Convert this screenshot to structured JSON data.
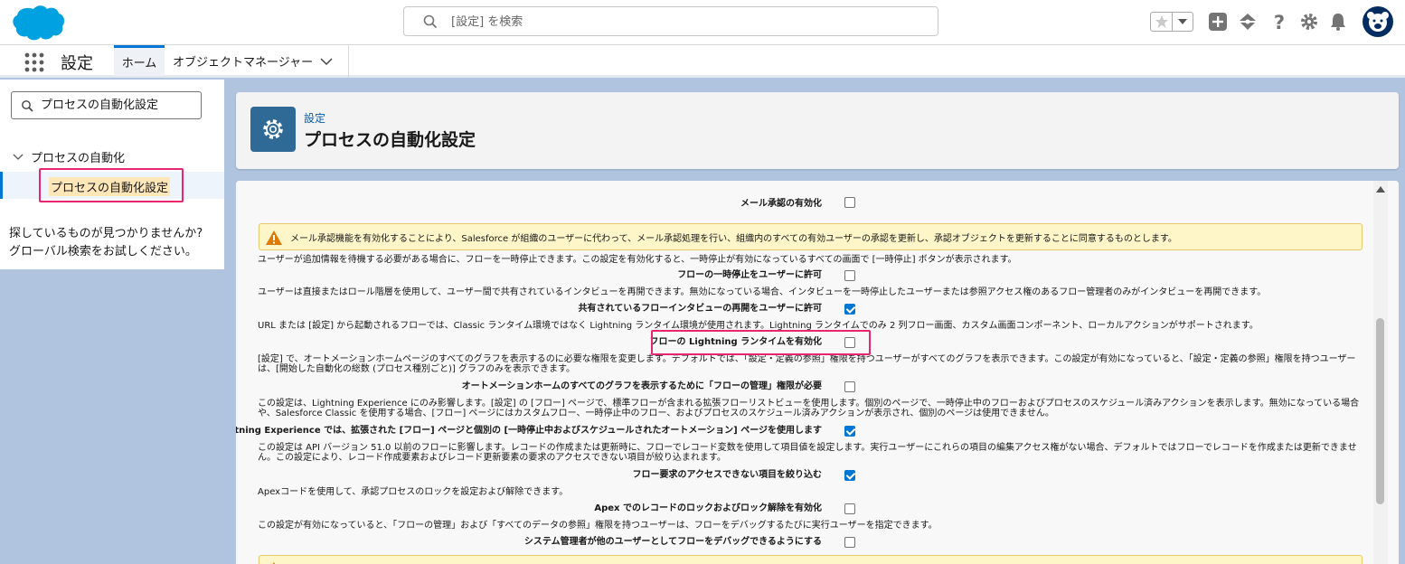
{
  "search": {
    "placeholder": "[設定] を検索"
  },
  "nav": {
    "app_name": "設定",
    "tab_home": "ホーム",
    "tab_object_manager": "オブジェクトマネージャー"
  },
  "sidebar": {
    "quickfind_value": "プロセスの自動化設定",
    "tree_parent": "プロセスの自動化",
    "tree_child": "プロセスの自動化設定",
    "not_found_line1": "探しているものが見つかりませんか?",
    "not_found_line2": "グローバル検索をお試しください。"
  },
  "header": {
    "breadcrumb": "設定",
    "title": "プロセスの自動化設定"
  },
  "settings": [
    {
      "label": "メール承認の有効化",
      "checked": false
    },
    {
      "warning": "メール承認機能を有効化することにより、Salesforce が組織のユーザーに代わって、メール承認処理を行い、組織内のすべての有効ユーザーの承認を更新し、承認オブジェクトを更新することに同意するものとします。"
    },
    {
      "desc": "ユーザーが追加情報を待機する必要がある場合に、フローを一時停止できます。この設定を有効化すると、一時停止が有効になっているすべての画面で [一時停止] ボタンが表示されます。",
      "label": "フローの一時停止をユーザーに許可",
      "checked": false
    },
    {
      "desc": "ユーザーは直接またはロール階層を使用して、ユーザー間で共有されているインタビューを再開できます。無効になっている場合、インタビューを一時停止したユーザーまたは参照アクセス権のあるフロー管理者のみがインタビューを再開できます。",
      "label": "共有されているフローインタビューの再開をユーザーに許可",
      "checked": true
    },
    {
      "desc": "URL または [設定] から起動されるフローでは、Classic ランタイム環境ではなく Lightning ランタイム環境が使用されます。Lightning ランタイムでのみ 2 列フロー画面、カスタム画面コンポーネント、ローカルアクションがサポートされます。",
      "label": "フローの Lightning ランタイムを有効化",
      "checked": false
    },
    {
      "desc": "[設定] で、オートメーションホームページのすべてのグラフを表示するのに必要な権限を変更します。デフォルトでは、「設定・定義の参照」権限を持つユーザーがすべてのグラフを表示できます。この設定が有効になっていると、「設定・定義の参照」権限を持つユーザーは、[開始した自動化の総数 (プロセス種別ごと)] グラフのみを表示できます。",
      "label": "オートメーションホームのすべてのグラフを表示するために「フローの管理」権限が必要",
      "checked": false
    },
    {
      "desc": "この設定は、Lightning Experience にのみ影響します。[設定] の [フロー] ページで、標準フローが含まれる拡張フローリストビューを使用します。個別のページで、一時停止中のフローおよびプロセスのスケジュール済みアクションを表示します。無効になっている場合や、Salesforce Classic を使用する場合、[フロー] ページにはカスタムフロー、一時停止中のフロー、およびプロセスのスケジュール済みアクションが表示され、個別のページは使用できません。",
      "label": "Lightning Experience では、拡張された [フロー] ページと個別の [一時停止中およびスケジュールされたオートメーション] ページを使用します",
      "checked": true
    },
    {
      "desc": "この設定は API バージョン 51.0 以前のフローに影響します。レコードの作成または更新時に、フローでレコード変数を使用して項目値を設定します。実行ユーザーにこれらの項目の編集アクセス権がない場合、デフォルトではフローでレコードを作成または更新できません。この設定により、レコード作成要素およびレコード更新要素の要求のアクセスできない項目が絞り込まれます。",
      "label": "フロー要求のアクセスできない項目を絞り込む",
      "checked": true
    },
    {
      "desc": "Apexコードを使用して、承認プロセスのロックを設定および解除できます。",
      "label": "Apex でのレコードのロックおよびロック解除を有効化",
      "checked": false
    },
    {
      "desc": "この設定が有効になっていると、「フローの管理」および「すべてのデータの参照」権限を持つユーザーは、フローをデバッグするたびに実行ユーザーを指定できます。",
      "label": "システム管理者が他のユーザーとしてフローをデバッグできるようにする",
      "checked": false
    }
  ],
  "colors": {
    "brand": "#00a1e0",
    "accent": "#0176d3",
    "highlight": "#e8256f",
    "background": "#b0c4df"
  },
  "icons": [
    "salesforce-cloud-logo",
    "search-icon",
    "star-icon",
    "chevron-down-icon",
    "add-icon",
    "trailhead-icon",
    "help-icon",
    "gear-icon",
    "bell-icon",
    "waffle-icon",
    "warning-icon"
  ]
}
